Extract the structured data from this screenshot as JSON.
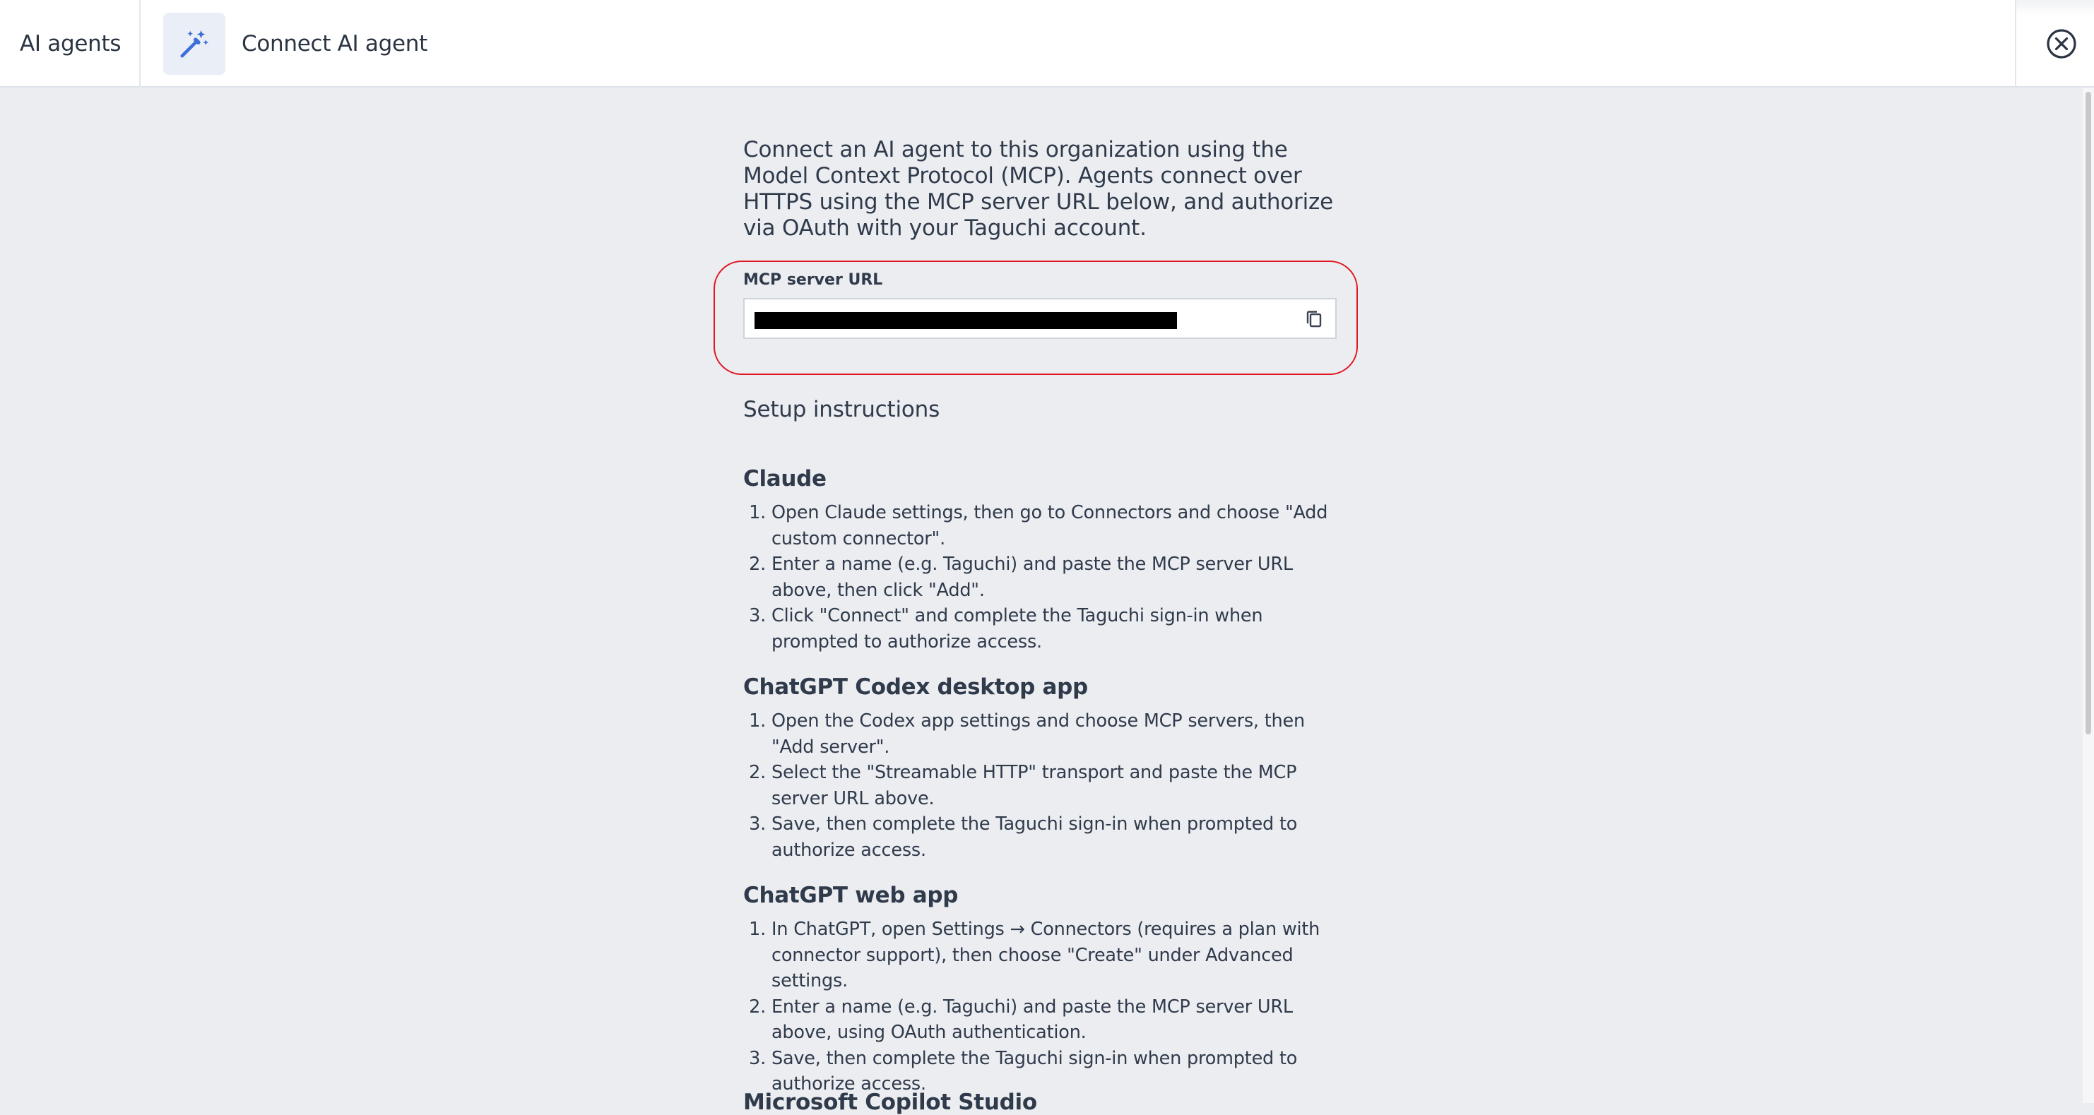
{
  "header": {
    "breadcrumb": "AI agents",
    "title": "Connect AI agent",
    "title_icon": "magic-wand-icon",
    "close_icon": "close-circle-icon"
  },
  "intro": "Connect an AI agent to this organization using the Model Context Protocol (MCP). Agents connect over HTTPS using the MCP server URL below, and authorize via OAuth with your Taguchi account.",
  "mcp_url": {
    "label": "MCP server URL",
    "value_redacted": true,
    "copy_icon": "copy-icon",
    "highlight_color": "#e0161f"
  },
  "setup": {
    "heading": "Setup instructions",
    "sections": [
      {
        "title": "Claude",
        "steps": [
          "Open Claude settings, then go to Connectors and choose \"Add custom connector\".",
          "Enter a name (e.g. Taguchi) and paste the MCP server URL above, then click \"Add\".",
          "Click \"Connect\" and complete the Taguchi sign-in when prompted to authorize access."
        ]
      },
      {
        "title": "ChatGPT Codex desktop app",
        "steps": [
          "Open the Codex app settings and choose MCP servers, then \"Add server\".",
          "Select the \"Streamable HTTP\" transport and paste the MCP server URL above.",
          "Save, then complete the Taguchi sign-in when prompted to authorize access."
        ]
      },
      {
        "title": "ChatGPT web app",
        "steps": [
          "In ChatGPT, open Settings → Connectors (requires a plan with connector support), then choose \"Create\" under Advanced settings.",
          "Enter a name (e.g. Taguchi) and paste the MCP server URL above, using OAuth authentication.",
          "Save, then complete the Taguchi sign-in when prompted to authorize access."
        ]
      },
      {
        "title": "Microsoft Copilot Studio",
        "steps": []
      }
    ]
  }
}
